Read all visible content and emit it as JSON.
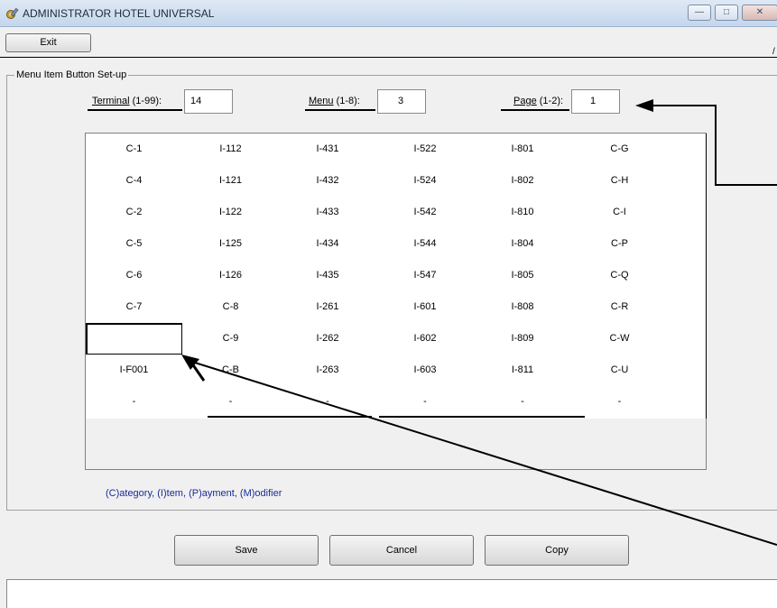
{
  "window": {
    "title": "ADMINISTRATOR HOTEL UNIVERSAL",
    "app_icon": "gear-wrench-icon",
    "controls": [
      "minimize-icon",
      "maximize-icon",
      "close-icon"
    ]
  },
  "toolbar": {
    "exit_label": "Exit",
    "edge_mark": "/"
  },
  "group": {
    "title": "Menu Item Button Set-up"
  },
  "fields": {
    "terminal": {
      "label_key": "Terminal",
      "label_rest": " (1-99):",
      "value": "14"
    },
    "menu": {
      "label_key": "Menu",
      "label_rest": " (1-8):",
      "value": "3"
    },
    "page": {
      "label_key": "Page",
      "label_rest": " (1-2):",
      "value": "1"
    }
  },
  "grid": {
    "rows": [
      [
        "C-1",
        "I-112",
        "I-431",
        "I-522",
        "I-801",
        "C-G",
        ""
      ],
      [
        "C-4",
        "I-121",
        "I-432",
        "I-524",
        "I-802",
        "C-H",
        ""
      ],
      [
        "C-2",
        "I-122",
        "I-433",
        "I-542",
        "I-810",
        "C-I",
        ""
      ],
      [
        "C-5",
        "I-125",
        "I-434",
        "I-544",
        "I-804",
        "C-P",
        ""
      ],
      [
        "C-6",
        "I-126",
        "I-435",
        "I-547",
        "I-805",
        "C-Q",
        ""
      ],
      [
        "C-7",
        "C-8",
        "I-261",
        "I-601",
        "I-808",
        "C-R",
        ""
      ],
      [
        "",
        "C-9",
        "I-262",
        "I-602",
        "I-809",
        "C-W",
        ""
      ],
      [
        "I-F001",
        "C-B",
        "I-263",
        "I-603",
        "I-811",
        "C-U",
        ""
      ],
      [
        "-",
        "-",
        "-",
        "-",
        "-",
        "-",
        ""
      ]
    ],
    "selected_row": 6,
    "selected_col": 0
  },
  "legend": "(C)ategory, (I)tem, (P)ayment, (M)odifier",
  "buttons": {
    "save": "Save",
    "cancel": "Cancel",
    "copy": "Copy"
  },
  "colors": {
    "legend_text": "#1a2a9a",
    "annotation_arrows": "#000000"
  }
}
